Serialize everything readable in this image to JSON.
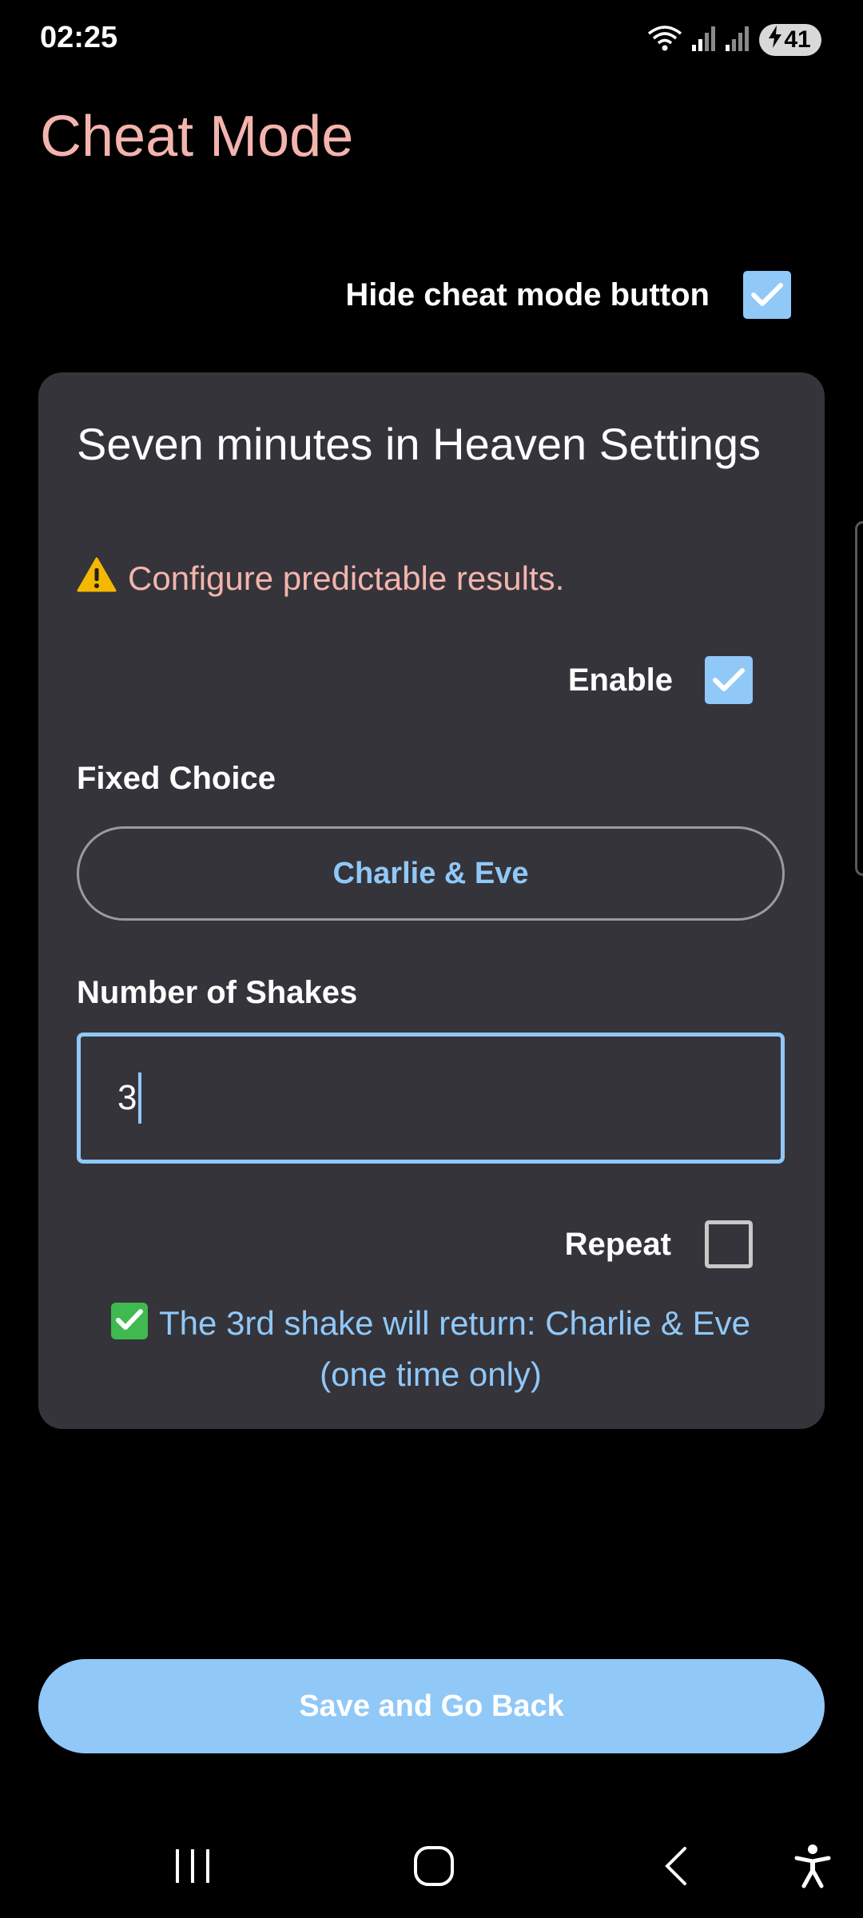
{
  "status_bar": {
    "time": "02:25",
    "battery_level": "41"
  },
  "page": {
    "title": "Cheat Mode"
  },
  "hide_cheat": {
    "label": "Hide cheat mode button",
    "checked": true
  },
  "card": {
    "title": "Seven minutes in Heaven Settings",
    "warning_icon": "⚠️",
    "warning_text": "Configure predictable results.",
    "enable": {
      "label": "Enable",
      "checked": true
    },
    "fixed_choice": {
      "label": "Fixed Choice",
      "value": "Charlie & Eve"
    },
    "shakes": {
      "label": "Number of Shakes",
      "value": "3"
    },
    "repeat": {
      "label": "Repeat",
      "checked": false
    },
    "result": {
      "line1": "The 3rd shake will return: Charlie & Eve",
      "line2": "(one time only)"
    }
  },
  "save_button": {
    "label": "Save and Go Back"
  },
  "nav_bar": {
    "icons": [
      "recent-apps-icon",
      "home-icon",
      "back-icon",
      "accessibility-icon"
    ]
  },
  "colors": {
    "title": "#f3b4ad",
    "accent": "#90c8f8",
    "card_background": "#35343b",
    "background": "#000000"
  }
}
